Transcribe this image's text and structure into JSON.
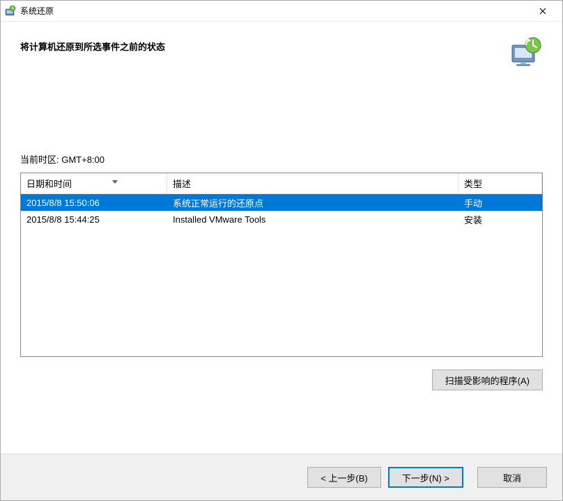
{
  "window": {
    "title": "系统还原"
  },
  "page": {
    "heading": "将计算机还原到所选事件之前的状态",
    "timezone_label": "当前时区: GMT+8:00"
  },
  "table": {
    "headers": {
      "date": "日期和时间",
      "desc": "描述",
      "type": "类型"
    },
    "rows": [
      {
        "date": "2015/8/8 15:50:06",
        "desc": "系统正常运行的还原点",
        "type": "手动",
        "selected": true
      },
      {
        "date": "2015/8/8 15:44:25",
        "desc": "Installed VMware Tools",
        "type": "安装",
        "selected": false
      }
    ]
  },
  "buttons": {
    "scan": "扫描受影响的程序(A)",
    "back": "< 上一步(B)",
    "next": "下一步(N) >",
    "cancel": "取消"
  }
}
